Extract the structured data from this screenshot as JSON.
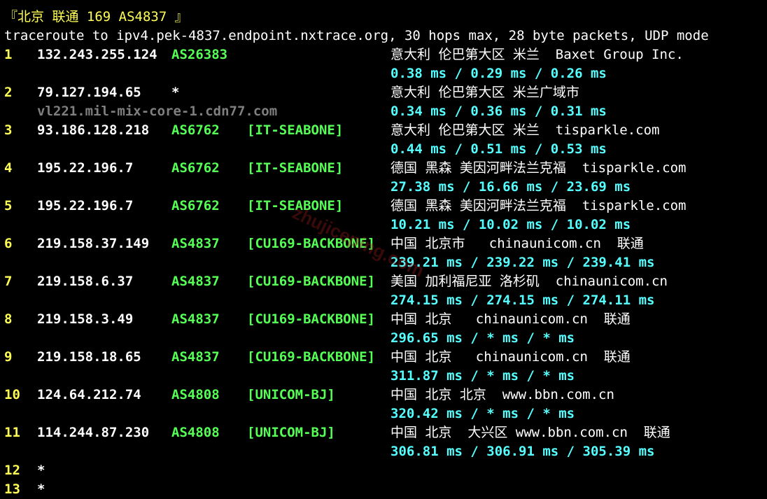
{
  "header": {
    "title": "『北京 联通 169 AS4837 』",
    "command": "traceroute to ipv4.pek-4837.endpoint.nxtrace.org, 30 hops max, 28 byte packets, UDP mode"
  },
  "watermark": "zhujiceping.com",
  "colors": {
    "background": "#000000",
    "hop_number": "#ffff55",
    "ip": "#ffffff",
    "asn": "#55ff55",
    "latency": "#55ffff",
    "hostname": "#7f7f7f"
  },
  "hops": [
    {
      "num": "1",
      "ip": "132.243.255.124",
      "asn": "AS26383",
      "tag": "",
      "geo": "意大利 伦巴第大区 米兰  Baxet Group Inc.",
      "rdns": "",
      "latency": "0.38 ms / 0.29 ms / 0.26 ms"
    },
    {
      "num": "2",
      "ip": "79.127.194.65",
      "asn": "*",
      "tag": "",
      "geo": "意大利 伦巴第大区 米兰广域市",
      "rdns": "vl221.mil-mix-core-1.cdn77.com",
      "latency": "0.34 ms / 0.36 ms / 0.31 ms"
    },
    {
      "num": "3",
      "ip": "93.186.128.218",
      "asn": "AS6762",
      "tag": "[IT-SEABONE]",
      "geo": "意大利 伦巴第大区 米兰  tisparkle.com",
      "rdns": "",
      "latency": "0.44 ms / 0.51 ms / 0.53 ms"
    },
    {
      "num": "4",
      "ip": "195.22.196.7",
      "asn": "AS6762",
      "tag": "[IT-SEABONE]",
      "geo": "德国 黑森 美因河畔法兰克福  tisparkle.com",
      "rdns": "",
      "latency": "27.38 ms / 16.66 ms / 23.69 ms"
    },
    {
      "num": "5",
      "ip": "195.22.196.7",
      "asn": "AS6762",
      "tag": "[IT-SEABONE]",
      "geo": "德国 黑森 美因河畔法兰克福  tisparkle.com",
      "rdns": "",
      "latency": "10.21 ms / 10.02 ms / 10.02 ms"
    },
    {
      "num": "6",
      "ip": "219.158.37.149",
      "asn": "AS4837",
      "tag": "[CU169-BACKBONE]",
      "geo": "中国 北京市   chinaunicom.cn  联通",
      "rdns": "",
      "latency": "239.21 ms / 239.22 ms / 239.41 ms"
    },
    {
      "num": "7",
      "ip": "219.158.6.37",
      "asn": "AS4837",
      "tag": "[CU169-BACKBONE]",
      "geo": "美国 加利福尼亚 洛杉矶  chinaunicom.cn",
      "rdns": "",
      "latency": "274.15 ms / 274.15 ms / 274.11 ms"
    },
    {
      "num": "8",
      "ip": "219.158.3.49",
      "asn": "AS4837",
      "tag": "[CU169-BACKBONE]",
      "geo": "中国 北京   chinaunicom.cn  联通",
      "rdns": "",
      "latency": "296.65 ms / * ms / * ms"
    },
    {
      "num": "9",
      "ip": "219.158.18.65",
      "asn": "AS4837",
      "tag": "[CU169-BACKBONE]",
      "geo": "中国 北京   chinaunicom.cn  联通",
      "rdns": "",
      "latency": "311.87 ms / * ms / * ms"
    },
    {
      "num": "10",
      "ip": "124.64.212.74",
      "asn": "AS4808",
      "tag": "[UNICOM-BJ]",
      "geo": "中国 北京 北京  www.bbn.com.cn",
      "rdns": "",
      "latency": "320.42 ms / * ms / * ms"
    },
    {
      "num": "11",
      "ip": "114.244.87.230",
      "asn": "AS4808",
      "tag": "[UNICOM-BJ]",
      "geo": "中国 北京  大兴区 www.bbn.com.cn  联通",
      "rdns": "",
      "latency": "306.81 ms / 306.91 ms / 305.39 ms"
    }
  ],
  "timeouts": [
    {
      "num": "12",
      "mark": "*"
    },
    {
      "num": "13",
      "mark": "*"
    }
  ]
}
